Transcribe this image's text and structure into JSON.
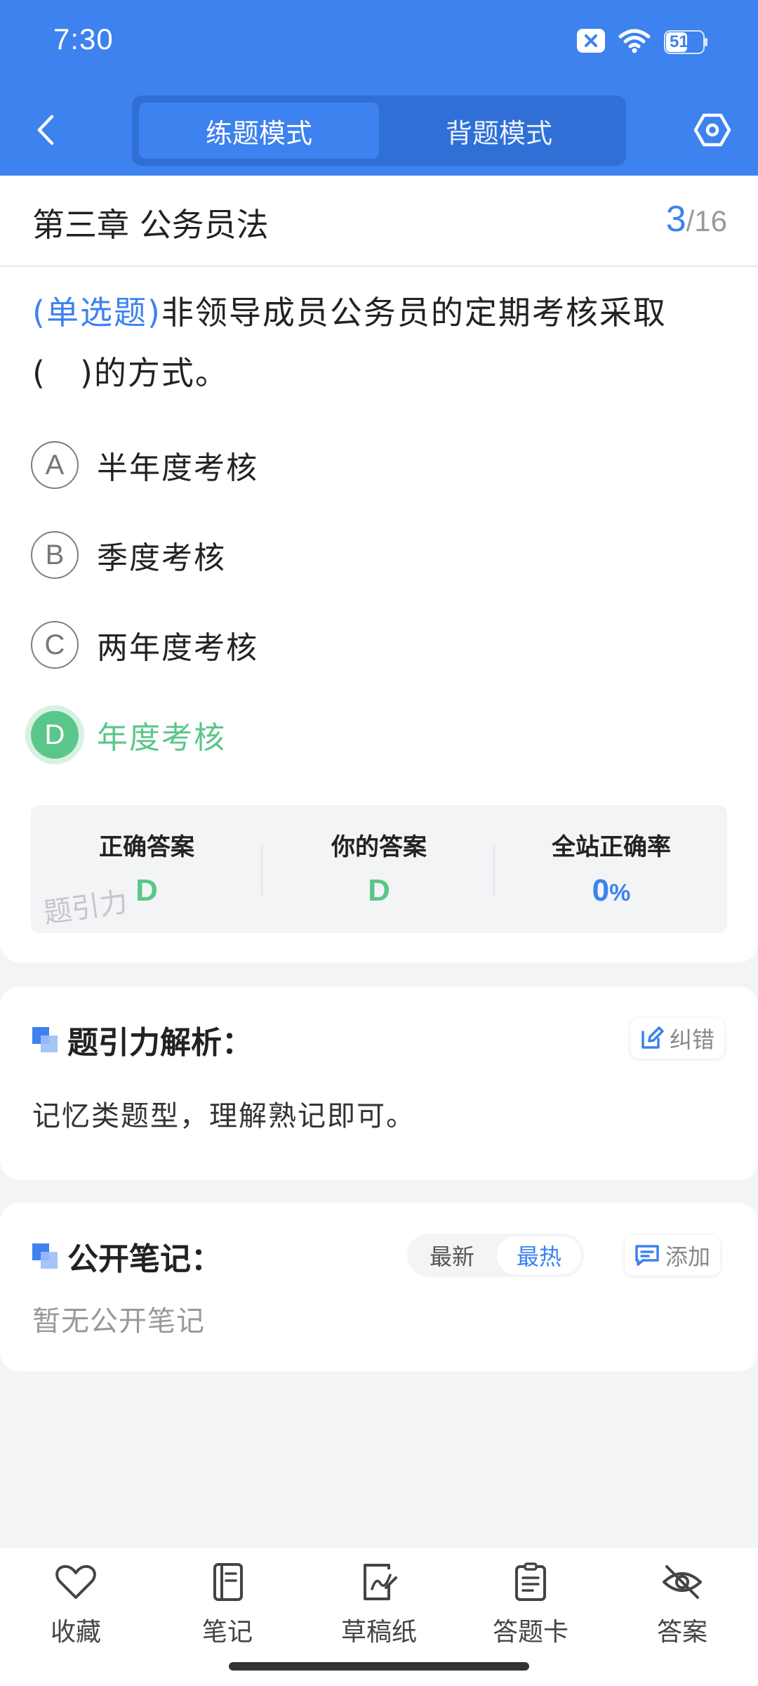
{
  "status_bar": {
    "time": "7:30",
    "battery": "51"
  },
  "header": {
    "modes": [
      {
        "label": "练题模式",
        "active": true
      },
      {
        "label": "背题模式",
        "active": false
      }
    ],
    "accent_color": "#3d82ee"
  },
  "chapter": {
    "title": "第三章 公务员法",
    "current": "3",
    "total": "/16"
  },
  "question": {
    "type": "(单选题)",
    "text": "非领导成员公务员的定期考核采取(　)的方式。",
    "options": [
      {
        "letter": "A",
        "text": "半年度考核"
      },
      {
        "letter": "B",
        "text": "季度考核"
      },
      {
        "letter": "C",
        "text": "两年度考核"
      },
      {
        "letter": "D",
        "text": "年度考核",
        "correct": true
      }
    ]
  },
  "answers": {
    "correct_label": "正确答案",
    "correct_value": "D",
    "yours_label": "你的答案",
    "yours_value": "D",
    "rate_label": "全站正确率",
    "rate_value": "0",
    "rate_unit": "%",
    "watermark": "题引力"
  },
  "analysis": {
    "title": "题引力解析：",
    "report_button": "纠错",
    "text": "记忆类题型，理解熟记即可。"
  },
  "notes": {
    "title": "公开笔记：",
    "sort_options": [
      {
        "label": "最新",
        "active": false
      },
      {
        "label": "最热",
        "active": true
      }
    ],
    "add_button": "添加",
    "empty_text": "暂无公开笔记"
  },
  "bottom_nav": [
    {
      "label": "收藏",
      "icon": "heart-icon"
    },
    {
      "label": "笔记",
      "icon": "notebook-icon"
    },
    {
      "label": "草稿纸",
      "icon": "draft-icon"
    },
    {
      "label": "答题卡",
      "icon": "answer-sheet-icon"
    },
    {
      "label": "答案",
      "icon": "eye-off-icon"
    }
  ]
}
